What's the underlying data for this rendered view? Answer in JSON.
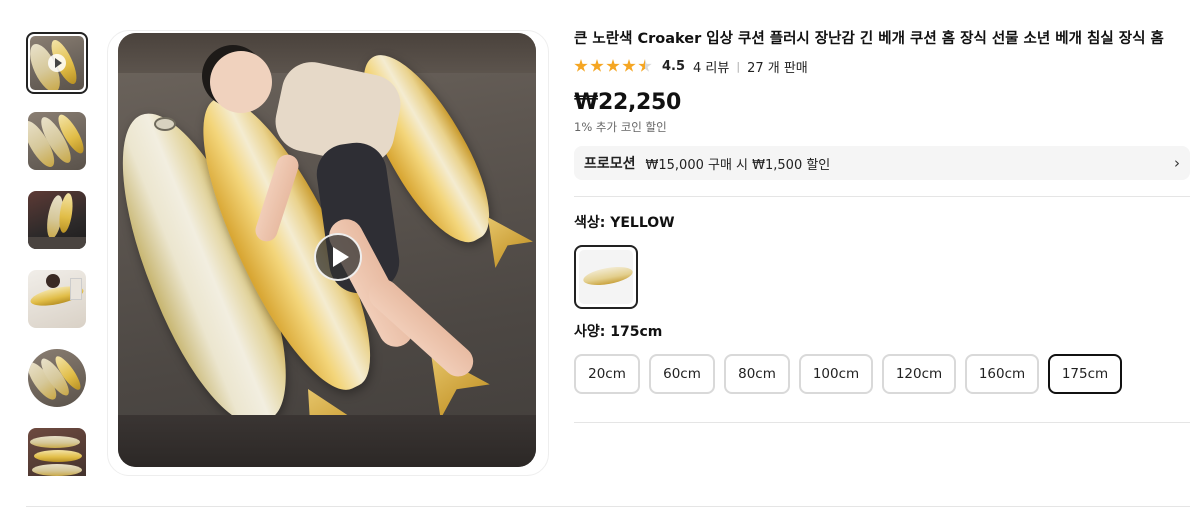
{
  "product": {
    "title": "큰 노란색 Croaker 입상 쿠션 플러시 장난감 긴 베개 쿠션 홈 장식 선물 소년 베개 침실 장식 홈",
    "rating_score": "4.5",
    "rating_value": 4.5,
    "reviews": "4 리뷰",
    "sales": "27 개 판매",
    "price": "₩22,250",
    "coin_discount": "1% 추가 코인 할인"
  },
  "promotion": {
    "tag": "프로모션",
    "text": "₩15,000 구매 시 ₩1,500 할인",
    "chevron_icon": "chevron-right-icon"
  },
  "color": {
    "label": "색상: YELLOW",
    "selected_swatch": "yellow-croaker-fish"
  },
  "size": {
    "label": "사양: 175cm",
    "options": [
      "20cm",
      "60cm",
      "80cm",
      "100cm",
      "120cm",
      "160cm",
      "175cm"
    ],
    "selected": "175cm"
  },
  "gallery": {
    "thumbnails": [
      "video-thumbnail",
      "fish-pillows-on-bed",
      "fish-pillow-in-dark-room",
      "girl-hugging-fish-pillow",
      "fish-pillows-round-view",
      "fish-pillows-stacked"
    ],
    "active_thumbnail": 0,
    "main_media": "video-girl-lying-on-fish-pillows",
    "play_icon": "play-icon"
  },
  "colors": {
    "star": "#f5a623",
    "selected_border": "#111111",
    "promo_bg": "#f5f5f5"
  }
}
